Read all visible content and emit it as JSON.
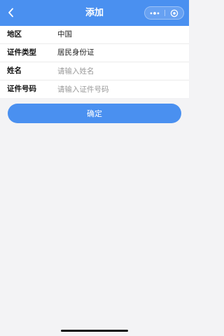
{
  "nav": {
    "title": "添加",
    "back_icon": "chevron-left-icon",
    "more_icon": "more-dots-icon",
    "close_icon": "target-close-icon",
    "background_color": "#4a90f0"
  },
  "form": {
    "region": {
      "label": "地区",
      "value": "中国"
    },
    "id_type": {
      "label": "证件类型",
      "value": "居民身份证"
    },
    "name": {
      "label": "姓名",
      "placeholder": "请输入姓名",
      "value": ""
    },
    "id_number": {
      "label": "证件号码",
      "placeholder": "请输入证件号码",
      "value": ""
    }
  },
  "confirm_button": {
    "label": "确定",
    "color": "#4a90f0"
  }
}
